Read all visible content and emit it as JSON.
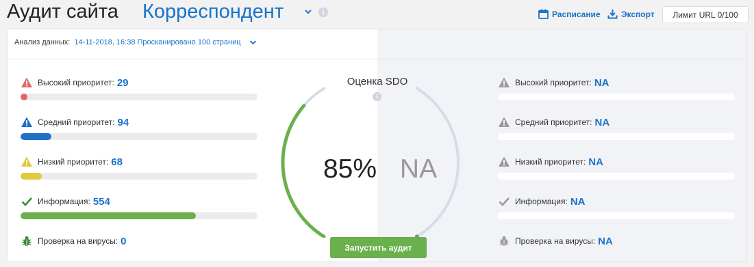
{
  "header": {
    "title": "Аудит сайта",
    "project": "Корреспондент",
    "schedule_label": "Расписание",
    "export_label": "Экспорт",
    "limit_label": "Лимит URL 0/100"
  },
  "analysis": {
    "label": "Анализ данных:",
    "value": "14-11-2018, 16:38 Просканировано 100 страниц"
  },
  "left_issues": [
    {
      "label": "Высокий приоритет:",
      "value": "29",
      "icon": "error-triangle-icon",
      "color": "#e06666",
      "fill": 0.03
    },
    {
      "label": "Средний приоритет:",
      "value": "94",
      "icon": "warning-triangle-icon",
      "color": "#1f6fc5",
      "fill": 0.13
    },
    {
      "label": "Низкий приоритет:",
      "value": "68",
      "icon": "notice-triangle-icon",
      "color": "#e0c93a",
      "fill": 0.09
    },
    {
      "label": "Информация:",
      "value": "554",
      "icon": "check-icon",
      "color": "#6ab04c",
      "fill": 0.74
    }
  ],
  "left_virus": {
    "label": "Проверка на вирусы:",
    "value": "0",
    "icon": "bug-icon",
    "color": "#6ab04c"
  },
  "right_issues": [
    {
      "label": "Высокий приоритет:",
      "value": "NA"
    },
    {
      "label": "Средний приоритет:",
      "value": "NA"
    },
    {
      "label": "Низкий приоритет:",
      "value": "NA"
    },
    {
      "label": "Информация:",
      "value": "NA"
    }
  ],
  "right_virus": {
    "label": "Проверка на вирусы:",
    "value": "NA"
  },
  "gauge": {
    "title": "Оценка SDO",
    "percent": "85%",
    "na": "NA",
    "value_fraction": 0.85,
    "color_active": "#6ab04c",
    "color_track": "#d6dcea"
  },
  "run_button": "Запустить аудит",
  "colors": {
    "accent": "#1a73c9",
    "muted_icon": "#999999"
  }
}
